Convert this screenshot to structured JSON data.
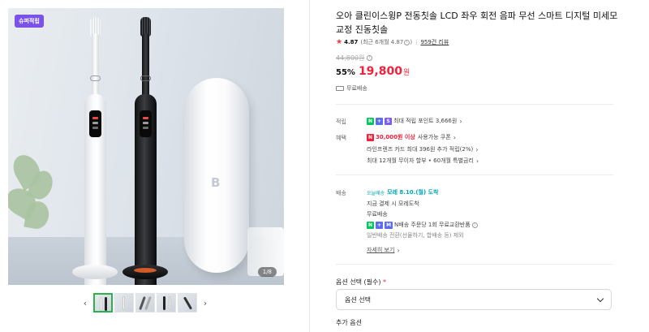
{
  "gallery": {
    "badge": "슈퍼적립",
    "counter": "1/8",
    "prev_arrow": "‹",
    "next_arrow": "›",
    "thumbnail_count": 5,
    "active_thumbnail": 1
  },
  "product": {
    "title": "오아 클린이스윙P 전동칫솔 LCD 좌우 회전 음파 무선 스마트 디지털 미세모 교정 진동칫솔",
    "rating": "4.87",
    "rating_detail": "(최근 6개월 4.87",
    "rating_close": ")",
    "reviews": "959건 리뷰",
    "original_price": "44,800원",
    "discount": "55%",
    "price": "19,800",
    "price_unit": "원",
    "shipping_note": "무료배송"
  },
  "benefits": {
    "points_label": "적립",
    "points_text": "최대 적립 포인트 3,666원",
    "benefit_label": "혜택",
    "coupon_amount": "30,000원 이상",
    "coupon_text": "사용가능 쿠폰",
    "card_text": "라인프렌즈 카드 최대 396원 추가 적립(2%)",
    "installment_text": "최대 12개월 무이자 할부 • 60개월 특별금리"
  },
  "delivery": {
    "label": "배송",
    "today_badge": "오늘배송",
    "arrival": "모레 8.10.(월) 도착",
    "payment_note": "지금 결제 시 모레도착",
    "free_ship": "무료배송",
    "nship_text": "N배송 주문당 1회 무료교환반품",
    "general_note": "일반배송 전환(선물하기, 합배송 등) 제외",
    "more_link": "자세히 보기"
  },
  "options": {
    "label": "옵션 선택 (필수)",
    "required_mark": "*",
    "select_value": "옵션 선택",
    "extra_label": "추가 옵션"
  },
  "colors": {
    "accent_red": "#f0213a",
    "naver_green": "#03c75a",
    "badge_purple": "#7a52e8",
    "teal": "#00a6b8"
  }
}
